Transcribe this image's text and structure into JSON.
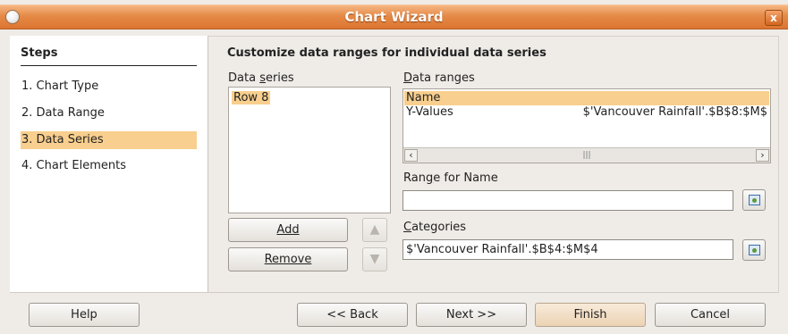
{
  "window": {
    "title": "Chart Wizard",
    "close_label": "x"
  },
  "steps": {
    "title": "Steps",
    "items": [
      {
        "label": "1. Chart Type"
      },
      {
        "label": "2. Data Range"
      },
      {
        "label": "3. Data Series"
      },
      {
        "label": "4. Chart Elements"
      }
    ],
    "active_index": 2
  },
  "main": {
    "title": "Customize data ranges for individual data series",
    "data_series_label": "Data series",
    "data_series_items": [
      "Row 8"
    ],
    "data_ranges_label": "Data ranges",
    "data_ranges": [
      {
        "name": "Name",
        "value": ""
      },
      {
        "name": "Y-Values",
        "value": "$'Vancouver Rainfall'.$B$8:$M$"
      }
    ],
    "range_for_name_label": "Range for Name",
    "range_for_name_value": "",
    "categories_label": "Categories",
    "categories_value": "$'Vancouver Rainfall'.$B$4:$M$4",
    "add_label": "Add",
    "remove_label": "Remove"
  },
  "buttons": {
    "help": "Help",
    "back": "<< Back",
    "next": "Next >>",
    "finish": "Finish",
    "cancel": "Cancel"
  },
  "colors": {
    "titlebar": "#dc7530",
    "selection": "#f8cf8e",
    "background": "#efebe7"
  }
}
